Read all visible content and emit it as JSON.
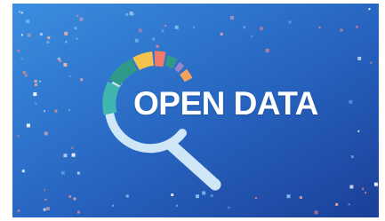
{
  "banner": {
    "title": "OPEN DATA",
    "icon_name": "magnifier-donut-chart-icon",
    "background_gradient": [
      "#2f7fd6",
      "#1d4fa6"
    ],
    "lens_ring_color": "#cfe6f7",
    "handle_color": "#cfe6f7",
    "segment_colors": [
      "#3fb7b0",
      "#f2c14e",
      "#f07b6b",
      "#2f9a8a",
      "#9b84c9",
      "#f5a25d"
    ],
    "dot_colors": [
      "#f48b8b",
      "#7fc8f0",
      "#ffffff",
      "#f7b0a8"
    ]
  }
}
